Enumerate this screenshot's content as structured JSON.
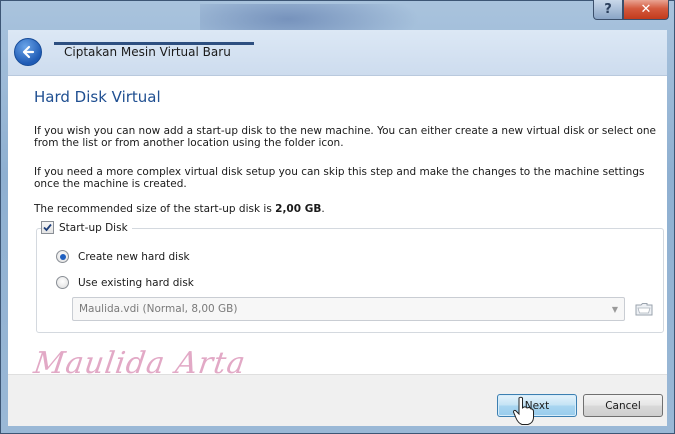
{
  "window": {
    "help_label": "?",
    "close_label": "✕"
  },
  "header": {
    "title": "Ciptakan Mesin Virtual Baru",
    "back_icon": "back-arrow-icon"
  },
  "page": {
    "heading": "Hard Disk Virtual",
    "paragraph1": "If you wish you can now add a start-up disk to the new machine. You can either create a new virtual disk or select one from the list or from another location using the folder icon.",
    "paragraph2": "If you need a more complex virtual disk setup you can skip this step and make the changes to the machine settings once the machine is created.",
    "recommended_prefix": "The recommended size of the start-up disk is ",
    "recommended_size": "2,00 GB",
    "recommended_suffix": "."
  },
  "startup_disk": {
    "label": "Start-up Disk",
    "checked": true,
    "options": [
      {
        "label": "Create new hard disk",
        "selected": true
      },
      {
        "label": "Use existing hard disk",
        "selected": false
      }
    ],
    "existing_disk_value": "Maulida.vdi (Normal, 8,00 GB)",
    "folder_icon": "folder-icon"
  },
  "watermark": "Maulida Arta",
  "footer": {
    "next_label": "Next",
    "cancel_label": "Cancel"
  },
  "colors": {
    "heading": "#1f4f91",
    "accent": "#1e5fc0",
    "close_button": "#c23a1c"
  }
}
